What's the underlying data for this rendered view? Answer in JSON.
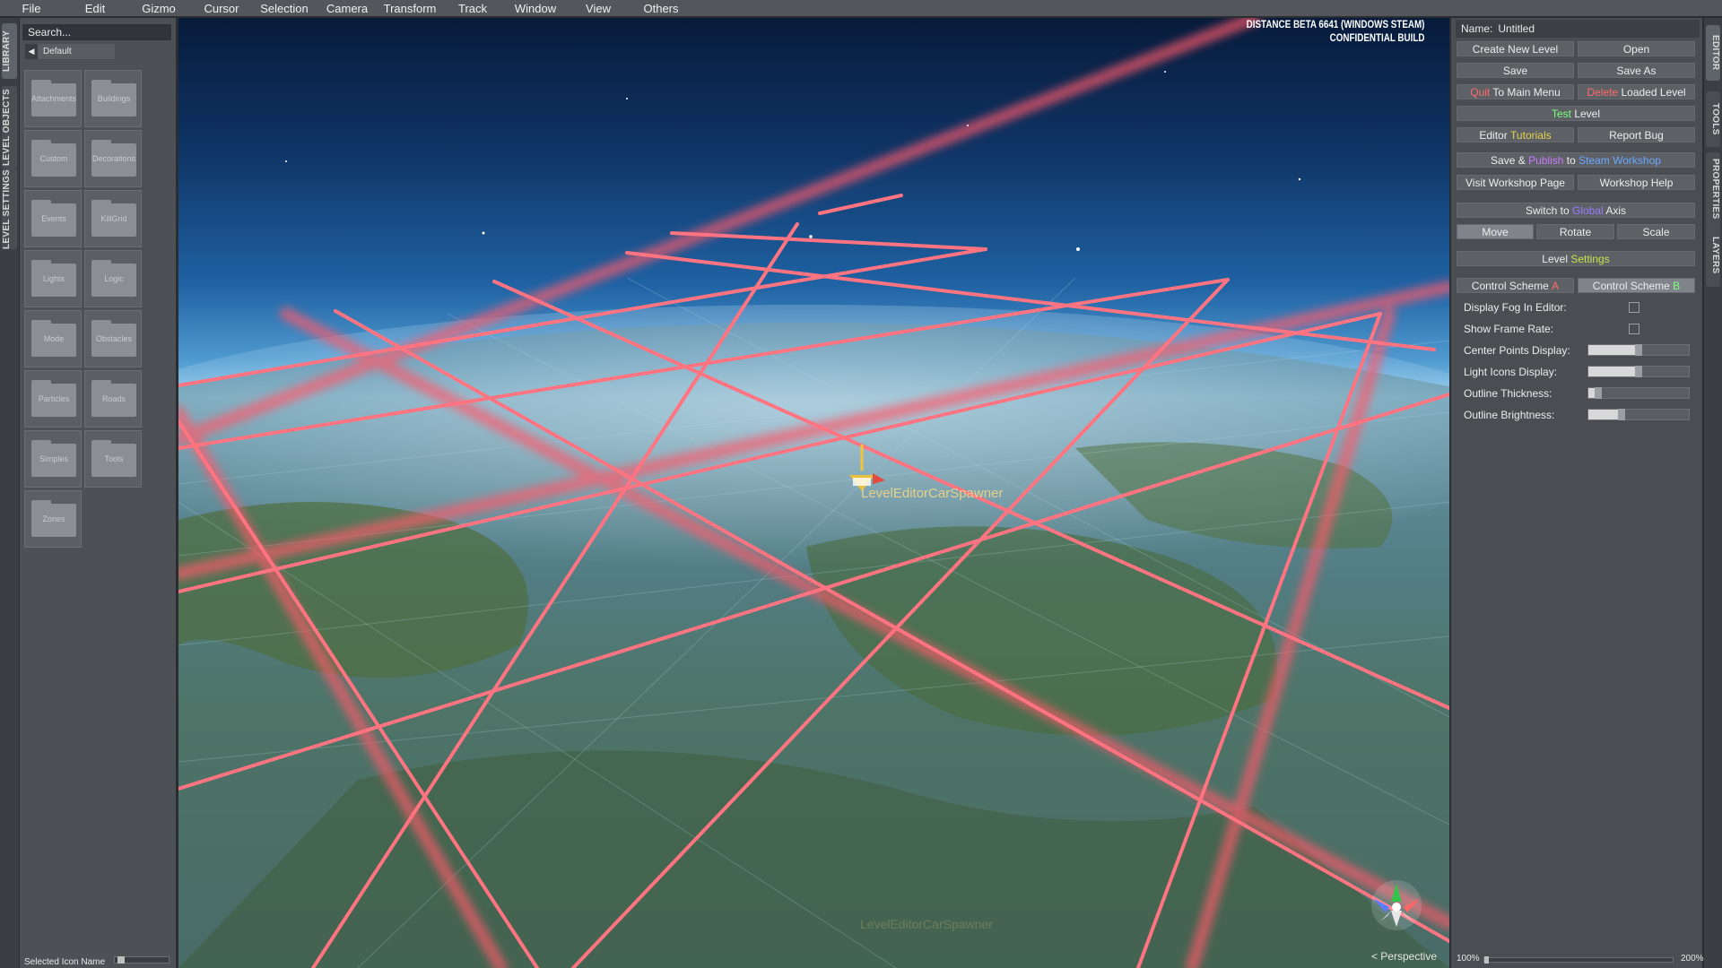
{
  "menu": [
    "File",
    "Edit",
    "Gizmo",
    "Cursor",
    "Selection",
    "Camera",
    "Transform",
    "Track",
    "Window",
    "View",
    "Others"
  ],
  "left_tabs": {
    "library": "LIBRARY",
    "level_objects": "LEVEL OBJECTS",
    "level_settings": "LEVEL SETTINGS"
  },
  "library": {
    "search_placeholder": "Search...",
    "breadcrumb": "Default",
    "folders": [
      "Attachments",
      "Buildings",
      "Custom",
      "Decorations",
      "Events",
      "KillGrid",
      "Lights",
      "Logic",
      "Mode",
      "Obstacles",
      "Particles",
      "Roads",
      "Simples",
      "Tools",
      "Zones"
    ],
    "selected_icon_name": "Selected Icon Name"
  },
  "viewport": {
    "build_line1": "DISTANCE BETA 6641 (WINDOWS STEAM)",
    "build_line2": "CONFIDENTIAL BUILD",
    "object_label": "LevelEditorCarSpawner",
    "ghost_label": "LevelEditorCarSpawner",
    "view_mode": "< Perspective"
  },
  "editor": {
    "name_label": "Name:",
    "name_value": "Untitled",
    "create_new_level": "Create New Level",
    "open": "Open",
    "save": "Save",
    "save_as": "Save As",
    "quit_a": "Quit",
    "quit_b": " To Main Menu",
    "delete_a": "Delete",
    "delete_b": " Loaded Level",
    "test_a": "Test",
    "test_b": " Level",
    "editor_a": "Editor ",
    "editor_b": "Tutorials",
    "report_bug": "Report Bug",
    "publish_a": "Save & ",
    "publish_b": "Publish",
    "publish_c": " to ",
    "publish_d": "Steam Workshop",
    "visit_workshop": "Visit Workshop Page",
    "workshop_help": "Workshop Help",
    "switch_a": "Switch to ",
    "switch_b": "Global",
    "switch_c": " Axis",
    "move": "Move",
    "rotate": "Rotate",
    "scale": "Scale",
    "level_settings_a": "Level ",
    "level_settings_b": "Settings",
    "scheme_a_1": "Control Scheme ",
    "scheme_a_2": "A",
    "scheme_b_1": "Control Scheme ",
    "scheme_b_2": "B",
    "display_fog": "Display Fog In Editor:",
    "show_frame_rate": "Show Frame Rate:",
    "center_points": "Center Points Display:",
    "light_icons": "Light Icons Display:",
    "outline_thickness": "Outline Thickness:",
    "outline_brightness": "Outline Brightness:",
    "zoom_min": "100%",
    "zoom_max": "200%"
  },
  "sliders": {
    "center_points": 0.5,
    "light_icons": 0.5,
    "outline_thickness": 0.1,
    "outline_brightness": 0.33,
    "icon_size": 0.05,
    "zoom": 0.0
  },
  "right_tabs": {
    "editor": "EDITOR",
    "tools": "TOOLS",
    "properties": "PROPERTIES",
    "layers": "LAYERS"
  },
  "colors": {
    "grid": "#ff6f7c",
    "accent_red": "#ff6a6a",
    "accent_green": "#7dff7d",
    "accent_blue": "#6aa8ff"
  }
}
